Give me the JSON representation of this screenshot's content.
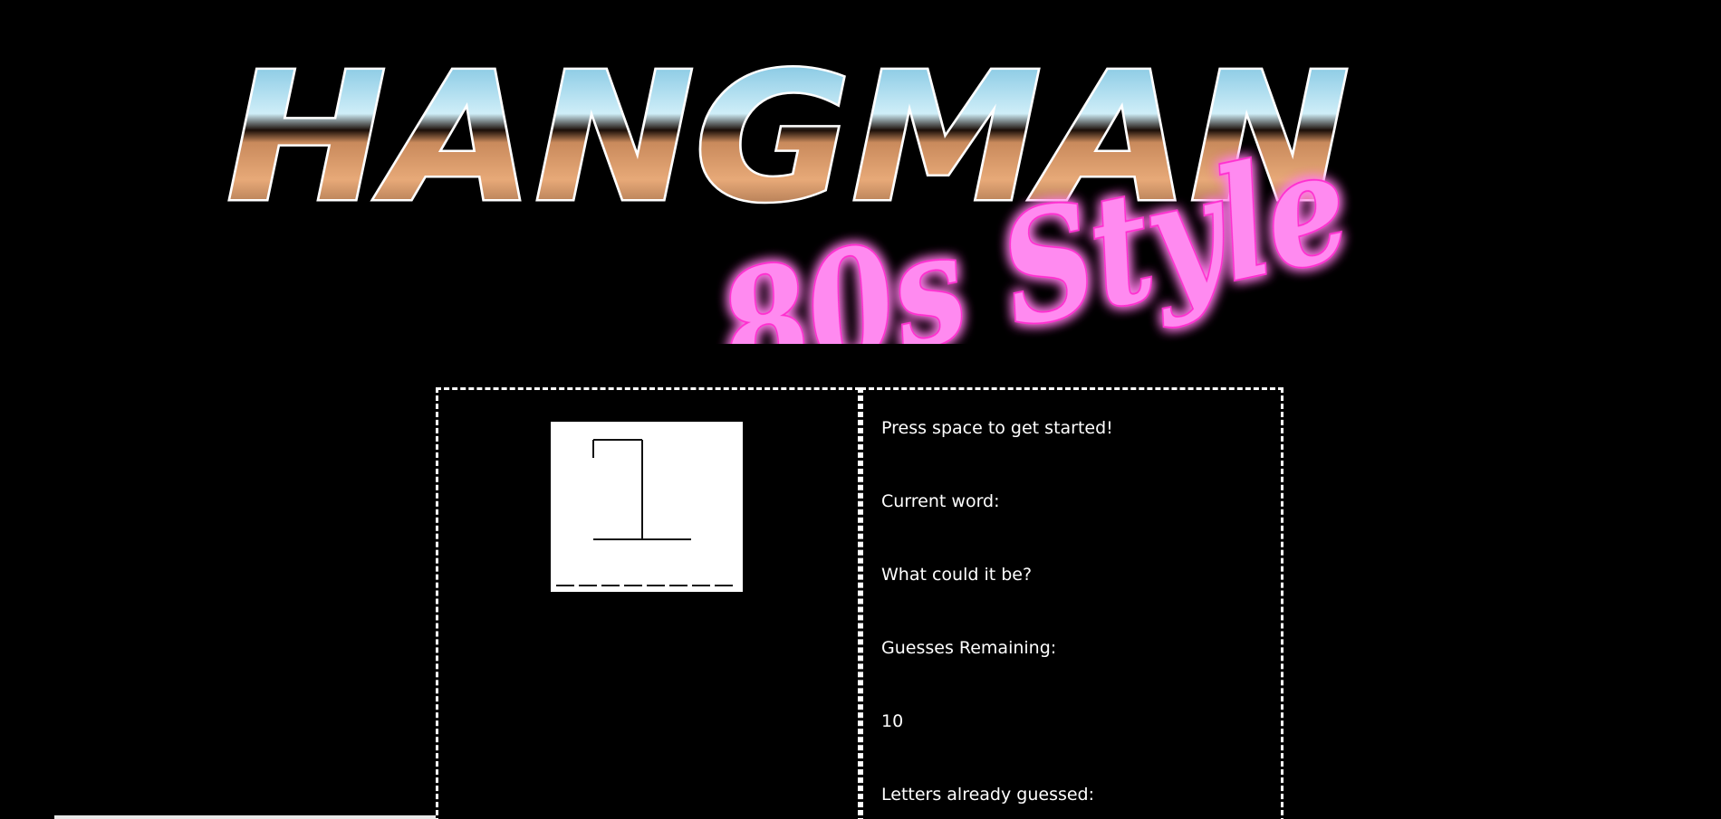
{
  "title": {
    "main": "HANGMAN",
    "script": "80s Style",
    "colors": {
      "chrome_sky_top": "#5fb4d8",
      "chrome_sky_mid": "#cfeef8",
      "chrome_horizon": "#1a0e08",
      "chrome_gold": "#e7a978",
      "chrome_bronze": "#6b3f25",
      "neon_pink": "#ff5ee5",
      "neon_glow": "#ff2fd0"
    }
  },
  "game": {
    "prompt": "Press space to get started!",
    "current_word_label": "Current word:",
    "hint_label": "What could it be?",
    "guesses_remaining_label": "Guesses Remaining:",
    "guesses_remaining_value": "10",
    "letters_guessed_label": "Letters already guessed:"
  },
  "hangman_image": {
    "icon": "gallows-icon",
    "blank_slots": 8
  }
}
